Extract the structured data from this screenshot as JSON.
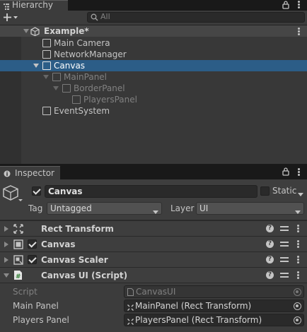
{
  "hierarchy": {
    "tab_label": "Hierarchy",
    "search_placeholder": "All",
    "scene_name": "Example*",
    "items": [
      {
        "label": "Main Camera"
      },
      {
        "label": "NetworkManager"
      },
      {
        "label": "Canvas"
      },
      {
        "label": "MainPanel"
      },
      {
        "label": "BorderPanel"
      },
      {
        "label": "PlayersPanel"
      },
      {
        "label": "EventSystem"
      }
    ]
  },
  "inspector": {
    "tab_label": "Inspector",
    "gameobject": {
      "name": "Canvas",
      "static_label": "Static",
      "tag_label": "Tag",
      "tag_value": "Untagged",
      "layer_label": "Layer",
      "layer_value": "UI"
    },
    "components": [
      {
        "name": "Rect Transform"
      },
      {
        "name": "Canvas"
      },
      {
        "name": "Canvas Scaler"
      },
      {
        "name": "Canvas UI (Script)"
      }
    ],
    "script_fields": {
      "script_label": "Script",
      "script_value": "CanvasUI",
      "main_panel_label": "Main Panel",
      "main_panel_value": "MainPanel (Rect Transform)",
      "players_panel_label": "Players Panel",
      "players_panel_value": "PlayersPanel (Rect Transform)"
    }
  },
  "colors": {
    "selection": "#2c5d87",
    "panel": "#383838",
    "header": "#3e3e3e"
  }
}
